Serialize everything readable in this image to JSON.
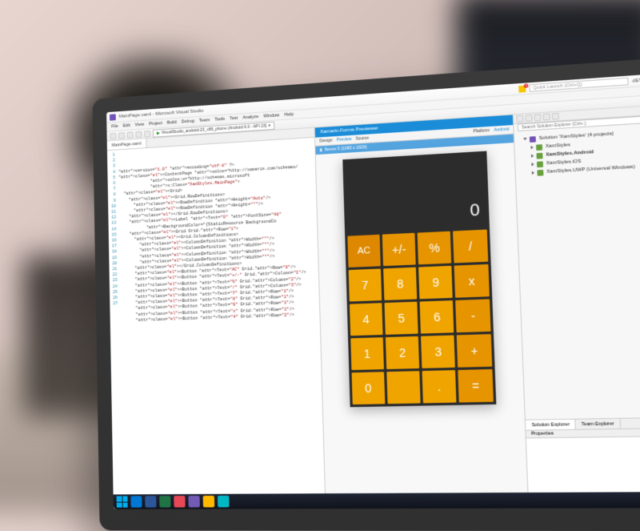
{
  "ide": {
    "title": "MainPage.xaml - Microsoft Visual Studio",
    "quick_launch_placeholder": "Quick Launch (Ctrl+Q)",
    "notification_count": "1",
    "account_text": "dEVEgnostico Eyma",
    "menus": [
      "File",
      "Edit",
      "View",
      "Project",
      "Build",
      "Debug",
      "Team",
      "Tools",
      "Test",
      "Analyze",
      "Window",
      "Help"
    ],
    "debug_target": "VisualStudio_android-23_x86_phone (Android 6.0 - API 23)"
  },
  "editor": {
    "tab": "MainPage.xaml",
    "code_lines": [
      "<?xml version=\"1.0\" encoding=\"utf-8\" ?>",
      "<ContentPage xmlns=\"http://xamarin.com/schemas/",
      "             xmlns:x=\"http://schemas.microsoft",
      "             x:Class=\"XamStyles.MainPage\">",
      "  <Grid>",
      "    <Grid.RowDefinitions>",
      "      <RowDefinition Height=\"Auto\"/>",
      "      <RowDefinition Height=\"*\"/>",
      "    </Grid.RowDefinitions>",
      "    <Label Text=\"0\" FontSize=\"48\"",
      "           BackgroundColor=\"{StaticResource BackgroundCo",
      "    <Grid Grid.Row=\"1\">",
      "      <Grid.ColumnDefinitions>",
      "        <ColumnDefinition Width=\"*\"/>",
      "        <ColumnDefinition Width=\"*\"/>",
      "        <ColumnDefinition Width=\"*\"/>",
      "        <ColumnDefinition Width=\"*\"/>",
      "      </Grid.ColumnDefinitions>",
      "      <Button Text=\"AC\" Grid.Row=\"0\"/>",
      "      <Button Text=\"+/-\" Grid.Column=\"1\"/>",
      "      <Button Text=\"%\" Grid.Column=\"2\"/>",
      "      <Button Text=\"/\" Grid.Column=\"3\"/>",
      "      <Button Text=\"7\" Grid.Row=\"1\"/>",
      "      <Button Text=\"8\" Grid.Row=\"1\"/>",
      "      <Button Text=\"9\" Grid.Row=\"1\"/>",
      "      <Button Text=\"x\" Grid.Row=\"1\"/>",
      "      <Button Text=\"4\" Grid.Row=\"2\"/>"
    ]
  },
  "previewer": {
    "title": "Xamarin.Forms Previewer",
    "tabs": [
      "Design",
      "Preview",
      "Source"
    ],
    "platform_label": "Platform",
    "platform_value": "Android",
    "device_label": "Nexus 5 (1080 x 1920)"
  },
  "calculator": {
    "display": "0",
    "keys": [
      {
        "label": "AC",
        "cls": "ac"
      },
      {
        "label": "+/-",
        "cls": "op"
      },
      {
        "label": "%",
        "cls": "op"
      },
      {
        "label": "/",
        "cls": "op"
      },
      {
        "label": "7",
        "cls": ""
      },
      {
        "label": "8",
        "cls": ""
      },
      {
        "label": "9",
        "cls": ""
      },
      {
        "label": "x",
        "cls": "op"
      },
      {
        "label": "4",
        "cls": ""
      },
      {
        "label": "5",
        "cls": ""
      },
      {
        "label": "6",
        "cls": ""
      },
      {
        "label": "-",
        "cls": "op"
      },
      {
        "label": "1",
        "cls": ""
      },
      {
        "label": "2",
        "cls": ""
      },
      {
        "label": "3",
        "cls": ""
      },
      {
        "label": "+",
        "cls": "op"
      },
      {
        "label": "0",
        "cls": ""
      },
      {
        "label": "",
        "cls": ""
      },
      {
        "label": ".",
        "cls": ""
      },
      {
        "label": "=",
        "cls": "op"
      }
    ]
  },
  "solution": {
    "panel_title": "Solution Explorer",
    "search_placeholder": "Search Solution Explorer (Ctrl+;)",
    "root": "Solution 'XamStyles' (4 projects)",
    "projects": [
      {
        "name": "XamStyles",
        "bold": false
      },
      {
        "name": "XamStyles.Android",
        "bold": true
      },
      {
        "name": "XamStyles.iOS",
        "bold": false
      },
      {
        "name": "XamStyles.UWP (Universal Windows)",
        "bold": false
      }
    ],
    "bottom_tabs": [
      "Solution Explorer",
      "Team Explorer"
    ],
    "properties_title": "Properties"
  }
}
